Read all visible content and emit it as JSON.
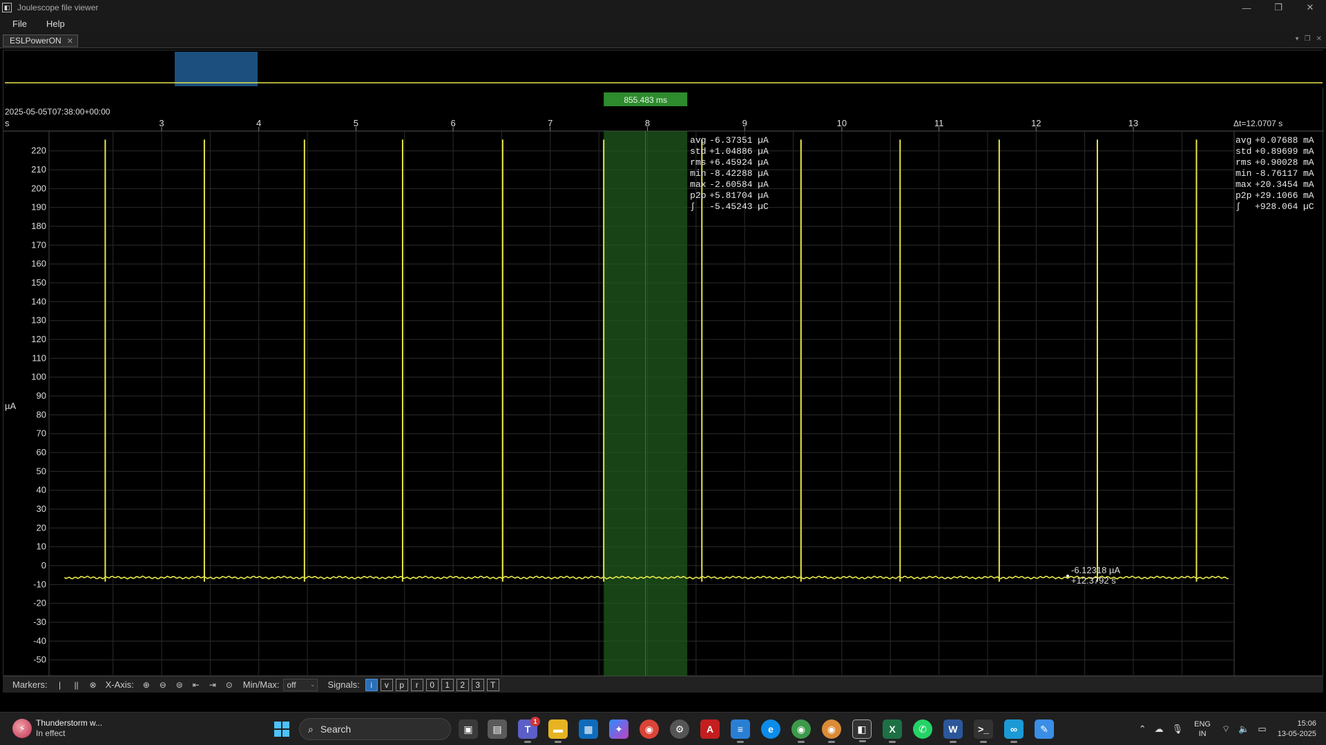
{
  "window": {
    "title": "Joulescope file viewer",
    "controls": {
      "minimize": "—",
      "restore": "❐",
      "close": "✕"
    }
  },
  "menu": {
    "items": [
      "File",
      "Help"
    ]
  },
  "tab": {
    "label": "ESLPowerON",
    "close": "✕"
  },
  "plot": {
    "timestamp": "2025-05-05T07:38:00+00:00",
    "x_unit": "s",
    "y_unit": "µA",
    "x_ticks": [
      "3",
      "4",
      "5",
      "6",
      "7",
      "8",
      "9",
      "10",
      "11",
      "12",
      "13"
    ],
    "y_ticks": [
      "220",
      "210",
      "200",
      "190",
      "180",
      "170",
      "160",
      "150",
      "140",
      "130",
      "120",
      "110",
      "100",
      "90",
      "80",
      "70",
      "60",
      "50",
      "40",
      "30",
      "20",
      "10",
      "0",
      "-10",
      "-20",
      "-30",
      "-40",
      "-50"
    ],
    "dual_marker": {
      "delta_label": "855.483 ms",
      "stats": [
        {
          "name": "avg",
          "value": "-6.37351",
          "unit": "µA"
        },
        {
          "name": "std",
          "value": "+1.04886",
          "unit": "µA"
        },
        {
          "name": "rms",
          "value": "+6.45924",
          "unit": "µA"
        },
        {
          "name": "min",
          "value": "-8.42288",
          "unit": "µA"
        },
        {
          "name": "max",
          "value": "-2.60584",
          "unit": "µA"
        },
        {
          "name": "p2p",
          "value": "+5.81704",
          "unit": "µA"
        },
        {
          "name": "∫",
          "value": "-5.45243",
          "unit": "µC"
        }
      ]
    },
    "total": {
      "delta_label": "Δt=12.0707 s",
      "stats": [
        {
          "name": "avg",
          "value": "+0.07688",
          "unit": "mA"
        },
        {
          "name": "std",
          "value": "+0.89699",
          "unit": "mA"
        },
        {
          "name": "rms",
          "value": "+0.90028",
          "unit": "mA"
        },
        {
          "name": "min",
          "value": "-8.76117",
          "unit": "mA"
        },
        {
          "name": "max",
          "value": "+20.3454",
          "unit": "mA"
        },
        {
          "name": "p2p",
          "value": "+29.1066",
          "unit": "mA"
        },
        {
          "name": "∫",
          "value": "+928.064",
          "unit": "µC"
        }
      ]
    },
    "hover": {
      "value": "-6.12318 µA",
      "time": "+12.3792 s"
    },
    "colors": {
      "trace": "#e8e84a",
      "marker_region": "#1f5a1f",
      "marker_label": "#2e8b2e",
      "nav_region": "#1c4f7e",
      "grid": "#2c2c2c"
    }
  },
  "chart_data": {
    "type": "line",
    "title": "",
    "xlabel": "s",
    "ylabel": "µA",
    "xlim": [
      2.0,
      14.0
    ],
    "ylim": [
      -50,
      220
    ],
    "baseline": -6.3,
    "series": [
      {
        "spikes_x": [
          2.42,
          3.44,
          4.47,
          5.48,
          6.51,
          7.55,
          8.56,
          9.58,
          10.6,
          11.62,
          12.63,
          13.65
        ]
      }
    ],
    "marker_range": [
      7.55,
      8.41
    ]
  },
  "toolbar": {
    "markers_label": "Markers:",
    "xaxis_label": "X-Axis:",
    "minmax_label": "Min/Max:",
    "minmax_value": "off",
    "signals_label": "Signals:",
    "signals": [
      "i",
      "v",
      "p",
      "r",
      "0",
      "1",
      "2",
      "3",
      "T"
    ]
  },
  "taskbar": {
    "weather_title": "Thunderstorm w...",
    "weather_sub": "In effect",
    "search_placeholder": "Search",
    "teams_badge": "1",
    "lang_top": "ENG",
    "lang_bottom": "IN",
    "time": "15:06",
    "date": "13-05-2025"
  }
}
